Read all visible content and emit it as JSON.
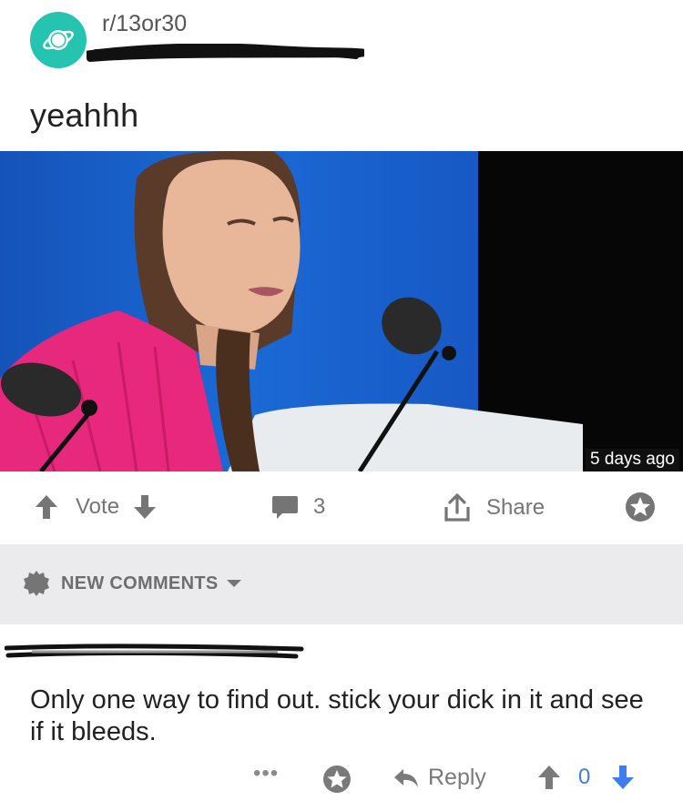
{
  "post": {
    "subreddit": "r/13or30",
    "title": "yeahhh",
    "image_timestamp": "5 days ago"
  },
  "actions": {
    "vote_label": "Vote",
    "comment_count": "3",
    "share_label": "Share"
  },
  "new_comments": {
    "label": "NEW COMMENTS"
  },
  "comment": {
    "text": "Only one way to find out. stick your dick in it and see if it bleeds.",
    "more_label": "•••",
    "reply_label": "Reply",
    "score": "0"
  },
  "colors": {
    "subreddit_avatar": "#24c4b0",
    "icon_gray": "#7a7a7a",
    "score_blue": "#3d7df0",
    "downvote_blue": "#3d7df0",
    "new_comments_bg": "#ebebed",
    "image_blue_bg": "#1a62c9",
    "shirt_pink": "#e8287c"
  },
  "icons": {
    "subreddit": "planet-icon",
    "upvote": "arrow-up-icon",
    "downvote": "arrow-down-icon",
    "comments": "speech-bubble-icon",
    "share": "share-upload-icon",
    "favorite": "star-icon",
    "new_comments": "gear-badge-icon",
    "dropdown": "chevron-down-icon",
    "reply": "reply-arrow-icon",
    "more": "more-dots-icon"
  }
}
